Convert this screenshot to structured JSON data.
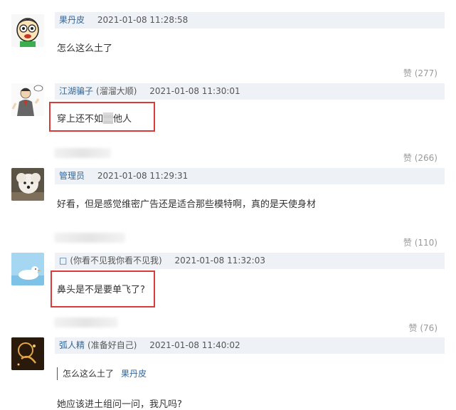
{
  "comments": [
    {
      "name": "果丹皮",
      "nick": "",
      "time": "2021-01-08 11:28:58",
      "text": "怎么这么土了",
      "likes": "赞 (277)"
    },
    {
      "name": "江湖骗子",
      "nick": "(溜溜大顺)",
      "time": "2021-01-08 11:30:01",
      "text_before": "穿上还不如",
      "text_after": "他人",
      "likes": "赞 (266)"
    },
    {
      "name": "管理员",
      "nick": "",
      "time": "2021-01-08 11:29:31",
      "text": "好看，但是感觉维密广告还是适合那些模特啊，真的是天使身材",
      "likes": "赞 (110)"
    },
    {
      "name": "□",
      "nick": "(你看不见我你看不见我)",
      "time": "2021-01-08 11:32:03",
      "text": "鼻头是不是要单飞了?",
      "likes": "赞 (76)"
    },
    {
      "name": "弧人精",
      "nick": "(准备好自己)",
      "time": "2021-01-08 11:40:02",
      "quote_text": "怎么这么土了",
      "quote_author": "果丹皮",
      "text": "她应该进土组问一问，我凡吗?"
    }
  ],
  "colors": {
    "header_bg": "#eef2f7",
    "name_link": "#336699",
    "highlight_box": "#d93a3a",
    "like_text": "#999999"
  }
}
